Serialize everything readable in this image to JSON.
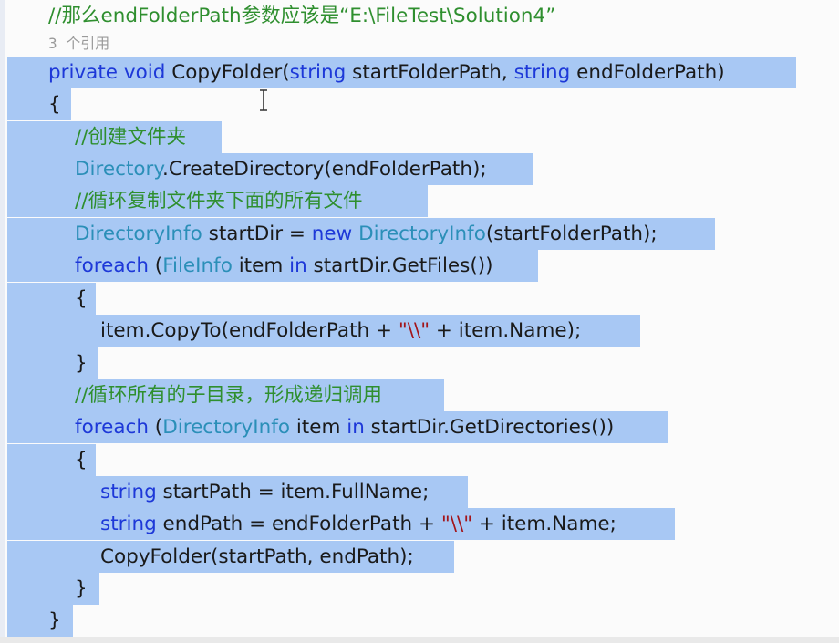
{
  "editor": {
    "header_comment": "//那么endFolderPath参数应该是“E:\\FileTest\\Solution4”",
    "codelens": "3 个引用",
    "lines": [
      {
        "id": "l1",
        "tokens": [
          {
            "c": "kw",
            "t": "private"
          },
          {
            "c": "pl",
            "t": " "
          },
          {
            "c": "kw",
            "t": "void"
          },
          {
            "c": "pl",
            "t": " CopyFolder("
          },
          {
            "c": "kw",
            "t": "string"
          },
          {
            "c": "pl",
            "t": " startFolderPath, "
          },
          {
            "c": "kw",
            "t": "string"
          },
          {
            "c": "pl",
            "t": " endFolderPath)"
          }
        ]
      },
      {
        "id": "l2",
        "tokens": [
          {
            "c": "pl",
            "t": "{"
          }
        ]
      },
      {
        "id": "l3",
        "tokens": [
          {
            "c": "cm",
            "t": "//创建文件夹"
          }
        ]
      },
      {
        "id": "l4",
        "tokens": [
          {
            "c": "ty",
            "t": "Directory"
          },
          {
            "c": "pl",
            "t": ".CreateDirectory(endFolderPath);"
          }
        ]
      },
      {
        "id": "l5",
        "tokens": [
          {
            "c": "cm",
            "t": "//循环复制文件夹下面的所有文件"
          }
        ]
      },
      {
        "id": "l6",
        "tokens": [
          {
            "c": "ty",
            "t": "DirectoryInfo"
          },
          {
            "c": "pl",
            "t": " startDir = "
          },
          {
            "c": "kw",
            "t": "new"
          },
          {
            "c": "pl",
            "t": " "
          },
          {
            "c": "ty",
            "t": "DirectoryInfo"
          },
          {
            "c": "pl",
            "t": "(startFolderPath);"
          }
        ]
      },
      {
        "id": "l7",
        "tokens": [
          {
            "c": "kw",
            "t": "foreach"
          },
          {
            "c": "pl",
            "t": " ("
          },
          {
            "c": "ty",
            "t": "FileInfo"
          },
          {
            "c": "pl",
            "t": " item "
          },
          {
            "c": "kw",
            "t": "in"
          },
          {
            "c": "pl",
            "t": " startDir.GetFiles())"
          }
        ]
      },
      {
        "id": "l8",
        "tokens": [
          {
            "c": "pl",
            "t": "{"
          }
        ]
      },
      {
        "id": "l9",
        "tokens": [
          {
            "c": "pl",
            "t": "item.CopyTo(endFolderPath + "
          },
          {
            "c": "st",
            "t": "\"\\\\\""
          },
          {
            "c": "pl",
            "t": " + item.Name);"
          }
        ]
      },
      {
        "id": "l10",
        "tokens": [
          {
            "c": "pl",
            "t": "}"
          }
        ]
      },
      {
        "id": "l11",
        "tokens": [
          {
            "c": "cm",
            "t": "//循环所有的子目录，形成递归调用"
          }
        ]
      },
      {
        "id": "l12",
        "tokens": [
          {
            "c": "kw",
            "t": "foreach"
          },
          {
            "c": "pl",
            "t": " ("
          },
          {
            "c": "ty",
            "t": "DirectoryInfo"
          },
          {
            "c": "pl",
            "t": " item "
          },
          {
            "c": "kw",
            "t": "in"
          },
          {
            "c": "pl",
            "t": " startDir.GetDirectories())"
          }
        ]
      },
      {
        "id": "l13",
        "tokens": [
          {
            "c": "pl",
            "t": "{"
          }
        ]
      },
      {
        "id": "l14",
        "tokens": [
          {
            "c": "kw",
            "t": "string"
          },
          {
            "c": "pl",
            "t": " startPath = item.FullName;"
          }
        ]
      },
      {
        "id": "l15",
        "tokens": [
          {
            "c": "kw",
            "t": "string"
          },
          {
            "c": "pl",
            "t": " endPath = endFolderPath + "
          },
          {
            "c": "st",
            "t": "\"\\\\\""
          },
          {
            "c": "pl",
            "t": " + item.Name;"
          }
        ]
      },
      {
        "id": "l16",
        "tokens": [
          {
            "c": "pl",
            "t": "CopyFolder(startPath, endPath);"
          }
        ]
      },
      {
        "id": "l17",
        "tokens": [
          {
            "c": "pl",
            "t": "}"
          }
        ]
      },
      {
        "id": "l18",
        "tokens": [
          {
            "c": "pl",
            "t": "}"
          }
        ]
      }
    ]
  },
  "colors": {
    "keyword": "#1d38d8",
    "type": "#2b8fb8",
    "comment": "#2f8f2f",
    "string": "#a3151a",
    "selection": "#a8c8f4"
  },
  "cursor_icon": "text-ibeam-icon"
}
